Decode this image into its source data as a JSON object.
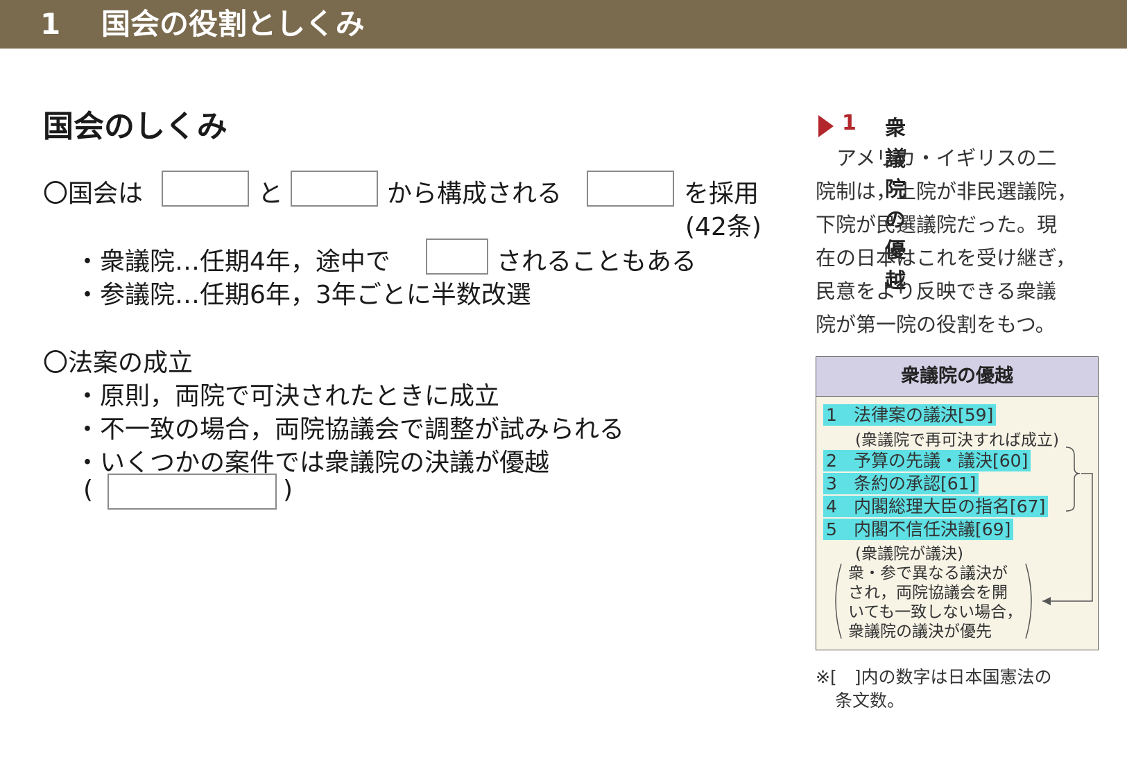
{
  "header": {
    "number": "1",
    "title": "国会の役割としくみ"
  },
  "section_title": "国会のしくみ",
  "main": {
    "line1": {
      "a": "〇国会は",
      "b": "と",
      "c": "から構成される",
      "d": "を採用"
    },
    "line1_ref": "(42条)",
    "shugiin": {
      "a": "・衆議院…任期4年，途中で",
      "b": "されることもある"
    },
    "sangiin": "・参議院…任期6年，3年ごとに半数改選",
    "bill_title": "〇法案の成立",
    "bill_items": [
      "・原則，両院で可決されたときに成立",
      "・不一致の場合，両院協議会で調整が試みられる",
      "・いくつかの案件では衆議院の決議が優越"
    ],
    "paren_open": "(",
    "paren_close": ")"
  },
  "side": {
    "num": "1",
    "title": "衆議院の優越",
    "para": [
      "アメリカ・イギリスの二",
      "院制は，上院が非民選議院，",
      "下院が民選議院だった。現",
      "在の日本はこれを受け継ぎ，",
      "民意をより反映できる衆議",
      "院が第一院の役割をもつ。"
    ]
  },
  "box": {
    "title": "衆議院の優越",
    "items": [
      {
        "idx": "1",
        "text": "法律案の議決[59]"
      },
      {
        "idx": "2",
        "text": "予算の先議・議決[60]"
      },
      {
        "idx": "3",
        "text": "条約の承認[61]"
      },
      {
        "idx": "4",
        "text": "内閣総理大臣の指名[67]"
      },
      {
        "idx": "5",
        "text": "内閣不信任決議[69]"
      }
    ],
    "note1": "(衆議院で再可決すれば成立)",
    "note2": "(衆議院が議決)",
    "paren_lines": [
      "衆・参で異なる議決が",
      "され，両院協議会を開",
      "いても一致しない場合，",
      "衆議院の議決が優先"
    ]
  },
  "footnote": [
    "※[　]内の数字は日本国憲法の",
    "条文数。"
  ]
}
